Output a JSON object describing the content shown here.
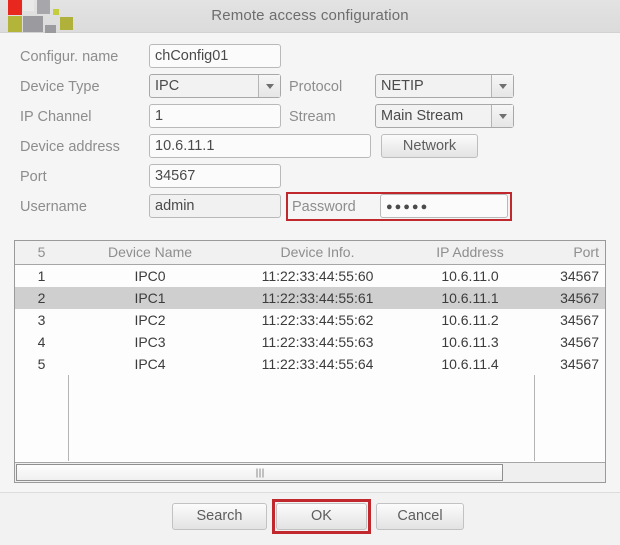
{
  "window": {
    "title": "Remote access configuration",
    "logo_colors": [
      "#e8281e",
      "#b3b43a",
      "#a6a6ab",
      "#8d8d92",
      "#c6cd3c",
      "#9a9a9f",
      "#b0b13a"
    ]
  },
  "form": {
    "config_name": {
      "label": "Configur. name",
      "value": "chConfig01"
    },
    "device_type": {
      "label": "Device Type",
      "value": "IPC"
    },
    "protocol": {
      "label": "Protocol",
      "value": "NETIP"
    },
    "ip_channel": {
      "label": "IP Channel",
      "value": "1"
    },
    "stream": {
      "label": "Stream",
      "value": "Main Stream"
    },
    "device_address": {
      "label": "Device address",
      "value": "10.6.11.1"
    },
    "network_button": "Network",
    "port": {
      "label": "Port",
      "value": "34567"
    },
    "username": {
      "label": "Username",
      "value": "admin"
    },
    "password": {
      "label": "Password",
      "value": "●●●●●"
    }
  },
  "highlights": {
    "password_box_color": "#c0282d",
    "ok_box_color": "#c0282d"
  },
  "table": {
    "headers": [
      "5",
      "Device Name",
      "Device Info.",
      "IP Address",
      "Port"
    ],
    "rows": [
      {
        "index": "1",
        "name": "IPC0",
        "info": "11:22:33:44:55:60",
        "ip": "10.6.11.0",
        "port": "34567",
        "selected": false
      },
      {
        "index": "2",
        "name": "IPC1",
        "info": "11:22:33:44:55:61",
        "ip": "10.6.11.1",
        "port": "34567",
        "selected": true
      },
      {
        "index": "3",
        "name": "IPC2",
        "info": "11:22:33:44:55:62",
        "ip": "10.6.11.2",
        "port": "34567",
        "selected": false
      },
      {
        "index": "4",
        "name": "IPC3",
        "info": "11:22:33:44:55:63",
        "ip": "10.6.11.3",
        "port": "34567",
        "selected": false
      },
      {
        "index": "5",
        "name": "IPC4",
        "info": "11:22:33:44:55:64",
        "ip": "10.6.11.4",
        "port": "34567",
        "selected": false
      }
    ]
  },
  "footer": {
    "search_label": "Search",
    "ok_label": "OK",
    "cancel_label": "Cancel"
  }
}
